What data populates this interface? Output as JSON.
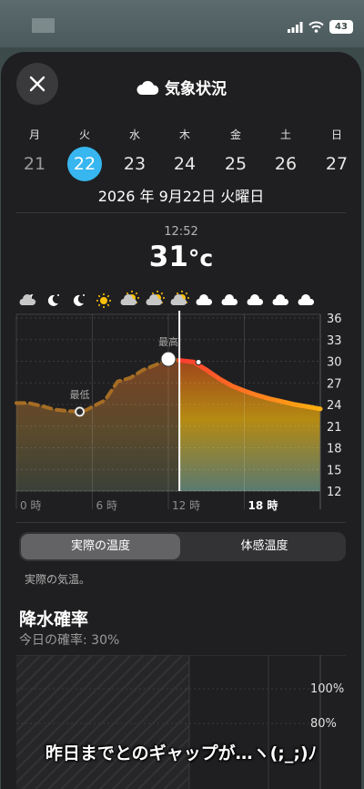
{
  "status_bar": {
    "battery": "43"
  },
  "header": {
    "title": "気象状況"
  },
  "week": {
    "weekdays": [
      "月",
      "火",
      "水",
      "木",
      "金",
      "土",
      "日"
    ],
    "dates": [
      "21",
      "22",
      "23",
      "24",
      "25",
      "26",
      "27"
    ],
    "selected_index": 1
  },
  "full_date": "2026 年 9月22日 火曜日",
  "current": {
    "time": "12:52",
    "temp": "31",
    "unit": "°c"
  },
  "chart_data": {
    "type": "line",
    "hourly_icons": [
      "partly-cloudy-night-icon",
      "moon-icon",
      "moon-icon",
      "sun-icon",
      "partly-sunny-icon",
      "partly-sunny-icon",
      "partly-sunny-icon",
      "cloud-icon",
      "cloud-icon",
      "cloud-icon",
      "cloud-icon",
      "cloud-icon"
    ],
    "x_ticks": [
      "0 時",
      "6 時",
      "12 時",
      "18 時"
    ],
    "y_ticks": [
      "36",
      "33",
      "30",
      "27",
      "24",
      "21",
      "18",
      "15",
      "12"
    ],
    "ylim": [
      12,
      36
    ],
    "xlim": [
      0,
      24
    ],
    "annotations": {
      "min": "最低",
      "max": "最高"
    },
    "series": [
      {
        "x": [
          0,
          1,
          2,
          3,
          4,
          5,
          5.5,
          6,
          7,
          8,
          9,
          10,
          11,
          12,
          13,
          14,
          15,
          16,
          17,
          18,
          19,
          20,
          21,
          22,
          23,
          24
        ],
        "y": [
          24.2,
          24.2,
          23.8,
          23.3,
          23.1,
          23.0,
          23.2,
          23.7,
          24.6,
          27.2,
          27.7,
          28.8,
          29.5,
          30.3,
          30.1,
          29.9,
          28.8,
          27.6,
          26.6,
          25.9,
          25.3,
          24.8,
          24.4,
          24.0,
          23.7,
          23.4
        ]
      }
    ],
    "current_hour": 12.87
  },
  "segmented": {
    "actual": "実際の温度",
    "feels_like": "体感温度",
    "description": "実際の気温。"
  },
  "precip": {
    "title": "降水確率",
    "subtitle": "今日の確率: 30%",
    "y_ticks": [
      "100%",
      "80%"
    ]
  },
  "caption": "昨日までとのギャップが…ヽ(;_;)ﾉ"
}
